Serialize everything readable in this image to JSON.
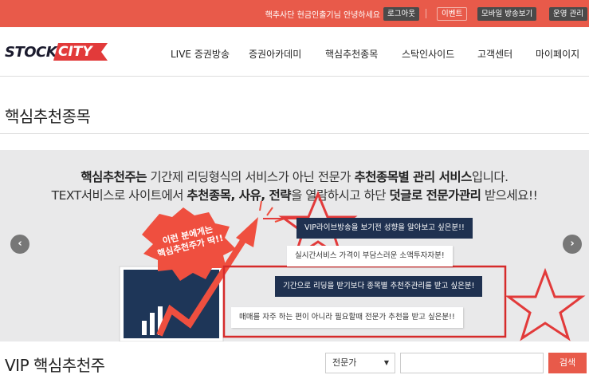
{
  "topbar": {
    "greeting": "핵추사단 현금인출기님 안녕하세요",
    "logout": "로그아웃",
    "event": "이벤트",
    "mobile": "모바일 방송보기",
    "admin": "운영 관리"
  },
  "logo": {
    "part1": "STOCK",
    "part2": "CITY"
  },
  "nav": {
    "items": [
      "LIVE 증권방송",
      "증권아카데미",
      "핵심추천종목",
      "스탁인사이드",
      "고객센터",
      "마이페이지"
    ]
  },
  "page": {
    "title": "핵심추천종목"
  },
  "banner": {
    "line1_a": "핵심추천주는",
    "line1_b": " 기간제 리딩형식의 서비스가 아닌 전문가 ",
    "line1_c": "추천종목별 관리 서비스",
    "line1_d": "입니다.",
    "line2_a": "TEXT서비스로 사이트에서 ",
    "line2_b": "추천종목, 사유, 전략",
    "line2_c": "을 열람하시고 하단 ",
    "line2_d": "덧글로 전문가관리",
    "line2_e": " 받으세요!!",
    "burst_line1": "이런 분에게는",
    "burst_line2": "핵심추천주가 딱!!",
    "callout1": "VIP라이브방송을 보기전 성향을 알아보고 싶은분!!",
    "callout2": "실시간서비스 가격이 부담스러운 소액투자자분!",
    "callout3": "기간으로 리딩을 받기보다 종목별 추천주관리를 받고 싶은분!",
    "callout4": "매매를 자주 하는 편이 아니라  필요할때 전문가 추천을 받고 싶은분!!",
    "prev": "‹",
    "next": "›"
  },
  "vip": {
    "title": "VIP 핵심추천주",
    "filter_selected": "전문가",
    "search_value": "",
    "search_button": "검색"
  },
  "colors": {
    "accent": "#e85a4a",
    "navy": "#1f3150",
    "banner_bg": "#e9e9ea"
  }
}
